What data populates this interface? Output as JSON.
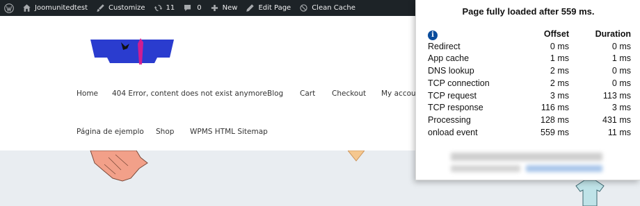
{
  "adminbar": {
    "site_name": "Joomunitedtest",
    "customize": "Customize",
    "updates_count": "11",
    "comments_count": "0",
    "new_label": "New",
    "edit_page": "Edit Page",
    "clean_cache": "Clean Cache"
  },
  "nav": {
    "items": [
      "Home",
      "404 Error, content does not exist anymore",
      "Blog",
      "Cart",
      "Checkout",
      "My accoun",
      "Página de ejemplo",
      "Shop",
      "WPMS HTML Sitemap"
    ]
  },
  "perf": {
    "title": "Page fully loaded after 559 ms.",
    "col_offset": "Offset",
    "col_duration": "Duration",
    "rows": [
      {
        "name": "Redirect",
        "offset": "0 ms",
        "duration": "0 ms"
      },
      {
        "name": "App cache",
        "offset": "1 ms",
        "duration": "1 ms"
      },
      {
        "name": "DNS lookup",
        "offset": "2 ms",
        "duration": "0 ms"
      },
      {
        "name": "TCP connection",
        "offset": "2 ms",
        "duration": "0 ms"
      },
      {
        "name": "TCP request",
        "offset": "3 ms",
        "duration": "113 ms"
      },
      {
        "name": "TCP response",
        "offset": "116 ms",
        "duration": "3 ms"
      },
      {
        "name": "Processing",
        "offset": "128 ms",
        "duration": "431 ms"
      },
      {
        "name": "onload event",
        "offset": "559 ms",
        "duration": "11 ms"
      }
    ]
  },
  "colors": {
    "adminbar_bg": "#1d2327",
    "info_icon": "#0a4c9c",
    "logo_blue": "#2a3ccf",
    "logo_pink": "#e0198a"
  },
  "icons": [
    "wordpress-icon",
    "home-icon",
    "brush-icon",
    "updates-icon",
    "comment-icon",
    "plus-icon",
    "pencil-icon",
    "trash-icon",
    "info-icon"
  ]
}
